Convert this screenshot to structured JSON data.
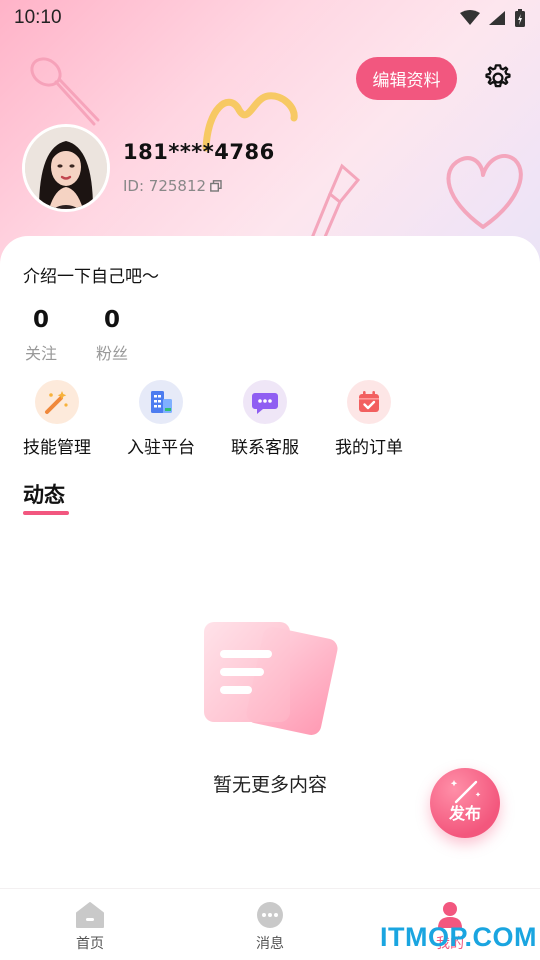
{
  "status_bar": {
    "time": "10:10"
  },
  "profile": {
    "edit_button": "编辑资料",
    "username": "181****4786",
    "id_text": "ID: 725812",
    "intro": "介绍一下自己吧～"
  },
  "stats": [
    {
      "value": "0",
      "label": "关注"
    },
    {
      "value": "0",
      "label": "粉丝"
    }
  ],
  "quick_actions": [
    {
      "label": "技能管理",
      "icon": "magic-wand-icon",
      "bg": "#fdeadb"
    },
    {
      "label": "入驻平台",
      "icon": "building-icon",
      "bg": "#e6eaf8"
    },
    {
      "label": "联系客服",
      "icon": "chat-bubble-icon",
      "bg": "#efe6f7"
    },
    {
      "label": "我的订单",
      "icon": "calendar-check-icon",
      "bg": "#fde6e6"
    }
  ],
  "feed": {
    "tab": "动态",
    "empty_text": "暂无更多内容"
  },
  "fab": {
    "label": "发布"
  },
  "bottom_nav": [
    {
      "label": "首页",
      "icon": "home-icon"
    },
    {
      "label": "消息",
      "icon": "message-icon"
    },
    {
      "label": "我的",
      "icon": "person-icon",
      "active": true
    }
  ],
  "watermark": "ITMOP.COM",
  "colors": {
    "accent": "#f2577f",
    "muted": "#999999"
  }
}
